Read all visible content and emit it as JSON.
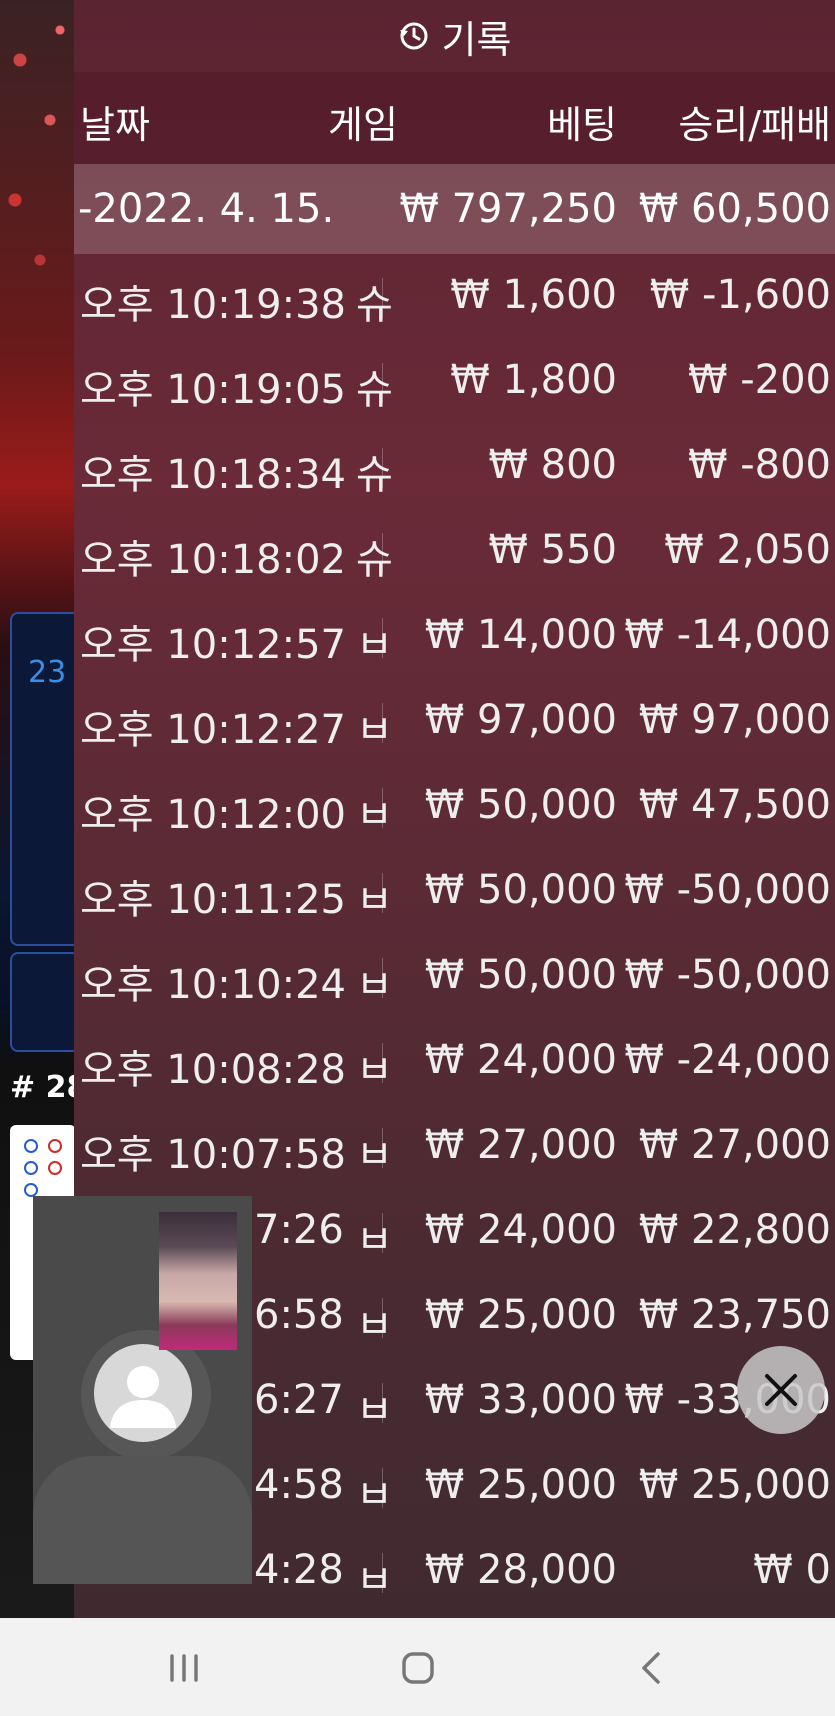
{
  "title": {
    "icon": "history-icon",
    "text": "기록"
  },
  "header": {
    "date": "날짜",
    "game": "게임",
    "bet": "베팅",
    "result": "승리/패배"
  },
  "date_row": {
    "date": "-2022. 4. 15.",
    "bet_total": "₩ 797,250",
    "result_total": "₩ 60,500"
  },
  "rows": [
    {
      "time": "오후 10:19:38",
      "game": "슈",
      "bet": "₩ 1,600",
      "result": "₩ -1,600"
    },
    {
      "time": "오후 10:19:05",
      "game": "슈",
      "bet": "₩ 1,800",
      "result": "₩ -200"
    },
    {
      "time": "오후 10:18:34",
      "game": "슈",
      "bet": "₩ 800",
      "result": "₩ -800"
    },
    {
      "time": "오후 10:18:02",
      "game": "슈",
      "bet": "₩ 550",
      "result": "₩ 2,050"
    },
    {
      "time": "오후 10:12:57",
      "game": "ㅂ",
      "bet": "₩ 14,000",
      "result": "₩ -14,000"
    },
    {
      "time": "오후 10:12:27",
      "game": "ㅂ",
      "bet": "₩ 97,000",
      "result": "₩ 97,000"
    },
    {
      "time": "오후 10:12:00",
      "game": "ㅂ",
      "bet": "₩ 50,000",
      "result": "₩ 47,500"
    },
    {
      "time": "오후 10:11:25",
      "game": "ㅂ",
      "bet": "₩ 50,000",
      "result": "₩ -50,000"
    },
    {
      "time": "오후 10:10:24",
      "game": "ㅂ",
      "bet": "₩ 50,000",
      "result": "₩ -50,000"
    },
    {
      "time": "오후 10:08:28",
      "game": "ㅂ",
      "bet": "₩ 24,000",
      "result": "₩ -24,000"
    },
    {
      "time": "오후 10:07:58",
      "game": "ㅂ",
      "bet": "₩ 27,000",
      "result": "₩ 27,000"
    },
    {
      "time": "7:26",
      "game": "ㅂ",
      "bet": "₩ 24,000",
      "result": "₩ 22,800"
    },
    {
      "time": "6:58",
      "game": "ㅂ",
      "bet": "₩ 25,000",
      "result": "₩ 23,750"
    },
    {
      "time": "6:27",
      "game": "ㅂ",
      "bet": "₩ 33,000",
      "result": "₩ -33,000"
    },
    {
      "time": "4:58",
      "game": "ㅂ",
      "bet": "₩ 25,000",
      "result": "₩ 25,000"
    },
    {
      "time": "4:28",
      "game": "ㅂ",
      "bet": "₩ 28,000",
      "result": "₩ 0"
    }
  ],
  "background": {
    "badge": "23",
    "hash": "# 28"
  },
  "icons": {
    "close": "close-icon",
    "chevron": "chevron-icon"
  },
  "navbar": {
    "recents": "recents-icon",
    "home": "home-icon",
    "back": "back-icon"
  }
}
